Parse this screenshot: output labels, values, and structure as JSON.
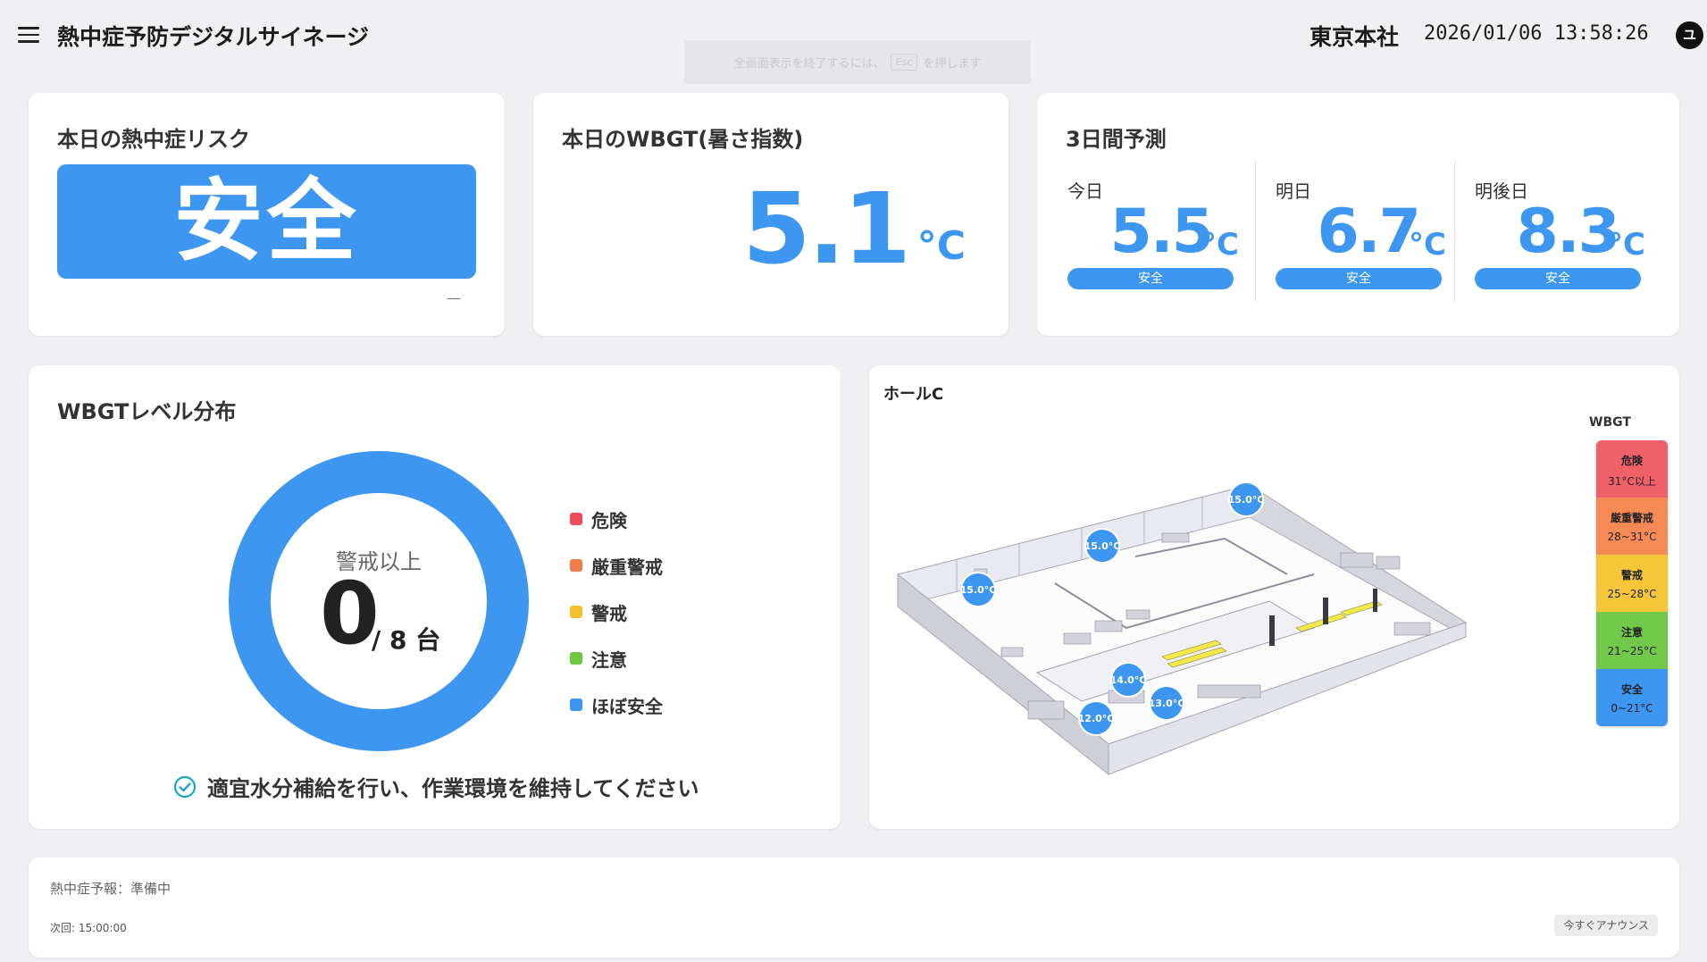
{
  "header": {
    "title": "熱中症予防デジタルサイネージ",
    "location": "東京本社",
    "datetime": "2026/01/06 13:58:26",
    "user_initial": "ユ"
  },
  "fullscreen_toast": {
    "prefix": "全画面表示を終了するには、",
    "key": "Esc",
    "suffix": "を押します"
  },
  "risk": {
    "title": "本日の熱中症リスク",
    "level": "安全",
    "note": "—",
    "color": "#3d96f0"
  },
  "wbgt": {
    "title": "本日のWBGT(暑さ指数)",
    "value": "5.1",
    "unit": "°C"
  },
  "forecast": {
    "title": "3日間予測",
    "days": [
      {
        "label": "今日",
        "value": "5.5",
        "unit": "°C",
        "level": "安全"
      },
      {
        "label": "明日",
        "value": "6.7",
        "unit": "°C",
        "level": "安全"
      },
      {
        "label": "明後日",
        "value": "8.3",
        "unit": "°C",
        "level": "安全"
      }
    ]
  },
  "distribution": {
    "title": "WBGTレベル分布",
    "caption": "警戒以上",
    "count": "0",
    "total": "/ 8 台",
    "legend": [
      {
        "label": "危険",
        "color": "#ef4b5a"
      },
      {
        "label": "厳重警戒",
        "color": "#f07b4b"
      },
      {
        "label": "警戒",
        "color": "#f5c02c"
      },
      {
        "label": "注意",
        "color": "#6cc83e"
      },
      {
        "label": "ほぼ安全",
        "color": "#3d96f0"
      }
    ],
    "advice": "適宜水分補給を行い、作業環境を維持してください",
    "chart_data": {
      "type": "pie",
      "categories": [
        "危険",
        "厳重警戒",
        "警戒",
        "注意",
        "ほぼ安全"
      ],
      "values": [
        0,
        0,
        0,
        0,
        8
      ]
    }
  },
  "map": {
    "hall": "ホールC",
    "sensors": [
      {
        "value": "15.0°C"
      },
      {
        "value": "15.0°C"
      },
      {
        "value": "15.0°C"
      },
      {
        "value": "14.0°C"
      },
      {
        "value": "13.0°C"
      },
      {
        "value": "12.0°C"
      }
    ],
    "legend_title": "WBGT",
    "legend": [
      {
        "name": "危険",
        "range": "31°C以上",
        "color": "#ef6068"
      },
      {
        "name": "厳重警戒",
        "range": "28~31°C",
        "color": "#f58a55"
      },
      {
        "name": "警戒",
        "range": "25~28°C",
        "color": "#f5c53a"
      },
      {
        "name": "注意",
        "range": "21~25°C",
        "color": "#72c84a"
      },
      {
        "name": "安全",
        "range": "0~21°C",
        "color": "#3d96f0"
      }
    ]
  },
  "announcement": {
    "status": "熱中症予報：準備中",
    "next": "次回: 15:00:00",
    "button": "今すぐアナウンス"
  }
}
